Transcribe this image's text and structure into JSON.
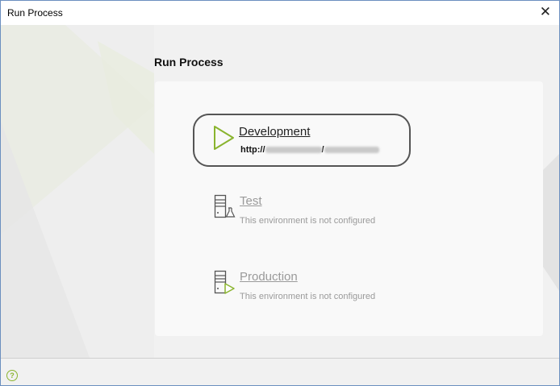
{
  "window": {
    "title": "Run Process",
    "close_glyph": "✕"
  },
  "main": {
    "heading": "Run Process"
  },
  "environments": [
    {
      "name": "Development",
      "url_prefix": "http://",
      "url_sep": "/",
      "icon": "play-icon"
    },
    {
      "name": "Test",
      "status": "This environment is not configured",
      "icon": "server-flask-icon"
    },
    {
      "name": "Production",
      "status": "This environment is not configured",
      "icon": "server-play-icon"
    }
  ],
  "footer": {
    "help_glyph": "?"
  },
  "colors": {
    "accent": "#8ab42f",
    "disabled_text": "#9a9a9a",
    "panel": "#f9f9f9"
  }
}
